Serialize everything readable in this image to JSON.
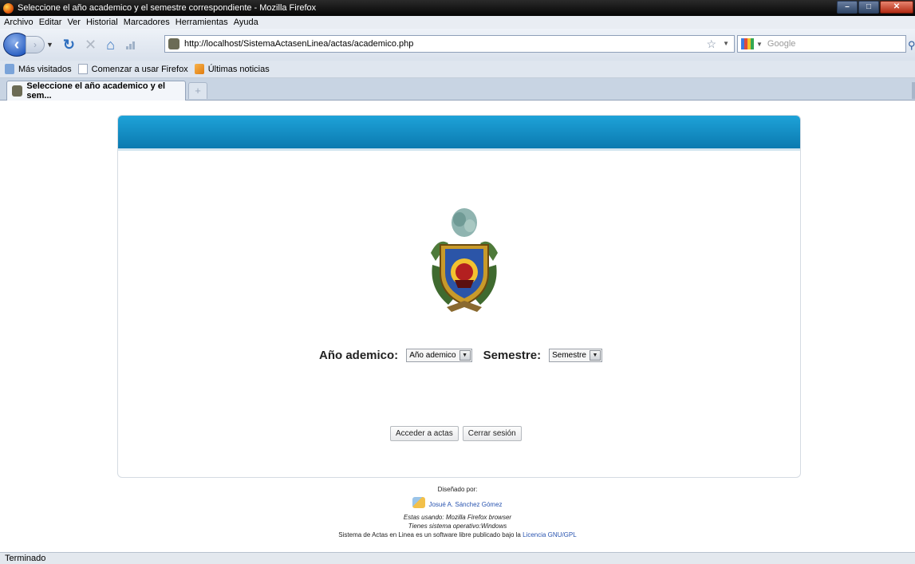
{
  "window": {
    "title": "Seleccione el año academico y el semestre correspondiente - Mozilla Firefox"
  },
  "menu": [
    "Archivo",
    "Editar",
    "Ver",
    "Historial",
    "Marcadores",
    "Herramientas",
    "Ayuda"
  ],
  "nav": {
    "url": "http://localhost/SistemaActasenLinea/actas/academico.php",
    "search_placeholder": "Google"
  },
  "bookmarks": [
    "Más visitados",
    "Comenzar a usar Firefox",
    "Últimas noticias"
  ],
  "tabs": [
    {
      "label": "Seleccione el año academico y el sem..."
    }
  ],
  "form": {
    "year_label": "Año ademico:",
    "year_value": "Año ademico",
    "semester_label": "Semestre:",
    "semester_value": "Semestre"
  },
  "buttons": {
    "access": "Acceder a actas",
    "logout": "Cerrar sesión"
  },
  "footer": {
    "designed_by": "Diseñado por:",
    "author": "Josué A. Sánchez Gómez",
    "browser_line": "Estas usando: Mozilla Firefox browser",
    "os_line": "Tienes sistema operativo:Windows",
    "license_text": "Sistema de Actas en Linea es un software libre publicado bajo la",
    "license_link": "Licencia GNU/GPL"
  },
  "status": "Terminado",
  "colors": {
    "header_blue": "#1ea3d8",
    "link_blue": "#2a55b0"
  }
}
